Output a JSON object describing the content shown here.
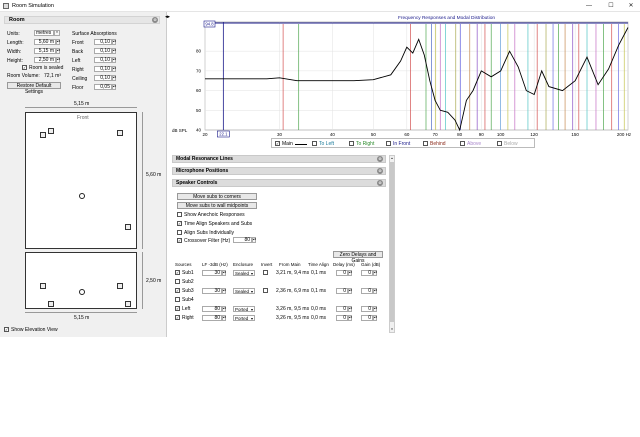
{
  "window": {
    "title": "Room Simulation",
    "minimize": "—",
    "maximize": "☐",
    "close": "✕"
  },
  "room_panel": {
    "title": "Room",
    "units_label": "Units:",
    "units_value": "metres",
    "length_label": "Length:",
    "length_value": "5,60 m",
    "width_label": "Width:",
    "width_value": "5,15 m",
    "height_label": "Height:",
    "height_value": "2,50 m",
    "sealed_label": "Room is sealed",
    "volume_label": "Room Volume:",
    "volume_value": "72,1 m³",
    "restore_label": "Restore Default Settings",
    "surface_title": "Surface Absorptions",
    "surfaces": [
      {
        "label": "Front",
        "value": "0,10"
      },
      {
        "label": "Back",
        "value": "0,10"
      },
      {
        "label": "Left",
        "value": "0,10"
      },
      {
        "label": "Right",
        "value": "0,10"
      },
      {
        "label": "Ceiling",
        "value": "0,10"
      },
      {
        "label": "Floor",
        "value": "0,05"
      }
    ]
  },
  "plan": {
    "width_dim": "5,15 m",
    "length_dim": "5,60 m",
    "front_label": "Front"
  },
  "elevation": {
    "height_dim": "2,50 m",
    "width_dim": "5,15 m"
  },
  "show_elevation": "Show Elevation View",
  "chart_data": {
    "type": "line",
    "title": "Frequency Responses and Modal Distribution",
    "x_scale": "log",
    "xlim": [
      20,
      200
    ],
    "x_ticks": [
      "20",
      "30",
      "40",
      "50",
      "60",
      "70",
      "80",
      "90",
      "100",
      "120",
      "150",
      "200 Hz"
    ],
    "ylim": [
      40,
      94.8
    ],
    "y_ticks": [
      "80",
      "70",
      "60",
      "50",
      "40"
    ],
    "y_unit": "dB SPL",
    "y_top_marker": "94.8",
    "x_marker": "22.1",
    "series": [
      {
        "name": "Main",
        "color": "#000000",
        "x": [
          20,
          22,
          25,
          28,
          30,
          33,
          36,
          40,
          45,
          50,
          55,
          58,
          60,
          62,
          64,
          66,
          68,
          70,
          72,
          75,
          78,
          80,
          83,
          86,
          90,
          95,
          100,
          105,
          110,
          115,
          120,
          125,
          130,
          140,
          150,
          160,
          170,
          180,
          190,
          200
        ],
        "y": [
          66,
          66,
          66,
          66,
          66.5,
          65,
          65,
          65,
          65,
          65.5,
          68,
          75,
          82,
          79,
          86,
          78,
          65,
          55,
          50,
          49,
          45,
          40,
          55,
          60,
          70,
          67,
          70,
          80,
          72,
          60,
          58,
          70,
          62,
          60,
          65,
          77,
          63,
          71,
          83,
          92
        ]
      }
    ],
    "legend": [
      {
        "label": "Main",
        "color": "#000000",
        "checked": true
      },
      {
        "label": "To Left",
        "color": "#1a7a9a",
        "checked": false
      },
      {
        "label": "To Right",
        "color": "#2a8a2a",
        "checked": false
      },
      {
        "label": "In Front",
        "color": "#1a1a8a",
        "checked": false
      },
      {
        "label": "Behind",
        "color": "#8a2a1a",
        "checked": false
      },
      {
        "label": "Above",
        "color": "#aa88cc",
        "checked": false
      },
      {
        "label": "Below",
        "color": "#aaaaaa",
        "checked": false
      }
    ],
    "mode_lines": [
      {
        "f": 30.6,
        "color": "#d04040"
      },
      {
        "f": 33.3,
        "color": "#40a040"
      },
      {
        "f": 61.2,
        "color": "#d04040"
      },
      {
        "f": 66.6,
        "color": "#40a040"
      },
      {
        "f": 68.6,
        "color": "#4060c0"
      },
      {
        "f": 70.2,
        "color": "#c0c040"
      },
      {
        "f": 72,
        "color": "#c060c0"
      },
      {
        "f": 74.1,
        "color": "#40c0c0"
      },
      {
        "f": 78.3,
        "color": "#a0a040"
      },
      {
        "f": 80.4,
        "color": "#6060e0"
      },
      {
        "f": 84.5,
        "color": "#c08040"
      },
      {
        "f": 88,
        "color": "#8040c0"
      },
      {
        "f": 91.8,
        "color": "#d04040"
      },
      {
        "f": 95,
        "color": "#40a040"
      },
      {
        "f": 99.9,
        "color": "#60a0e0"
      },
      {
        "f": 104,
        "color": "#c0c040"
      },
      {
        "f": 108,
        "color": "#c060c0"
      },
      {
        "f": 116,
        "color": "#40c0c0"
      },
      {
        "f": 122,
        "color": "#d04040"
      },
      {
        "f": 128,
        "color": "#a0a040"
      },
      {
        "f": 133,
        "color": "#6060e0"
      },
      {
        "f": 137,
        "color": "#40a040"
      },
      {
        "f": 142,
        "color": "#c08040"
      },
      {
        "f": 148,
        "color": "#8040c0"
      },
      {
        "f": 153,
        "color": "#d04040"
      },
      {
        "f": 160,
        "color": "#40c0c0"
      },
      {
        "f": 168,
        "color": "#c060c0"
      },
      {
        "f": 175,
        "color": "#40a040"
      },
      {
        "f": 183,
        "color": "#d04040"
      },
      {
        "f": 190,
        "color": "#6060e0"
      },
      {
        "f": 196,
        "color": "#c0c040"
      }
    ]
  },
  "sections": {
    "modal": "Modal Resonance Lines",
    "mic": "Microphone Positions",
    "speaker": "Speaker Controls"
  },
  "speaker_controls": {
    "move_corners": "Move subs to corners",
    "move_midpoints": "Move subs to wall midpoints",
    "show_anechoic": "Show Anechoic Responses",
    "time_align": "Time Align Speakers and Subs",
    "align_individually": "Align Subs Individually",
    "crossover_label": "Crossover Filter (Hz)",
    "crossover_value": "80",
    "zero_delays": "Zero Delays and Gains",
    "headers": {
      "sources": "Sources",
      "lf": "LF -3dB (Hz)",
      "enclosure": "Enclosure",
      "invert": "Invert",
      "from_main": "From Main",
      "time_align": "Time Align",
      "delay": "Delay (ms)",
      "gain": "Gain (dB)"
    },
    "rows": [
      {
        "name": "Sub1",
        "checked": true,
        "lf": "30",
        "enclosure": "Sealed",
        "invert": false,
        "from_main": "3,21 m, 9,4 ms",
        "time_align": "0,1 ms",
        "delay": "0",
        "gain": "0",
        "active": true
      },
      {
        "name": "Sub2",
        "checked": false,
        "active": false
      },
      {
        "name": "Sub3",
        "checked": true,
        "lf": "30",
        "enclosure": "Sealed",
        "invert": false,
        "from_main": "2,36 m, 6,9 ms",
        "time_align": "0,1 ms",
        "delay": "0",
        "gain": "0",
        "active": true
      },
      {
        "name": "Sub4",
        "checked": false,
        "active": false
      },
      {
        "name": "Left",
        "checked": true,
        "lf": "80",
        "enclosure": "Ported",
        "invert": null,
        "from_main": "3,26 m, 9,5 ms",
        "time_align": "0,0 ms",
        "delay": "0",
        "gain": "0",
        "active": true
      },
      {
        "name": "Right",
        "checked": true,
        "lf": "80",
        "enclosure": "Ported",
        "invert": null,
        "from_main": "3,26 m, 9,5 ms",
        "time_align": "0,0 ms",
        "delay": "0",
        "gain": "0",
        "active": true
      }
    ]
  }
}
